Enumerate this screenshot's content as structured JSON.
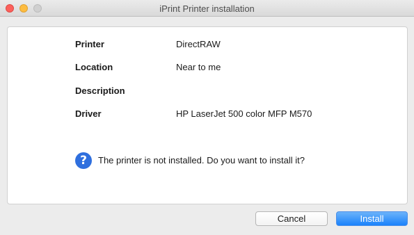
{
  "window": {
    "title": "iPrint Printer installation"
  },
  "details": {
    "printer": {
      "label": "Printer",
      "value": "DirectRAW"
    },
    "location": {
      "label": "Location",
      "value": "Near to me"
    },
    "description": {
      "label": "Description",
      "value": ""
    },
    "driver": {
      "label": "Driver",
      "value": "HP LaserJet 500 color MFP M570"
    }
  },
  "prompt": {
    "icon": "question-icon",
    "glyph": "?",
    "message": "The printer is not installed. Do you want to install it?"
  },
  "buttons": {
    "cancel_label": "Cancel",
    "install_label": "Install"
  },
  "colors": {
    "accent": "#1a82fb",
    "question_icon": "#2f6fde"
  }
}
